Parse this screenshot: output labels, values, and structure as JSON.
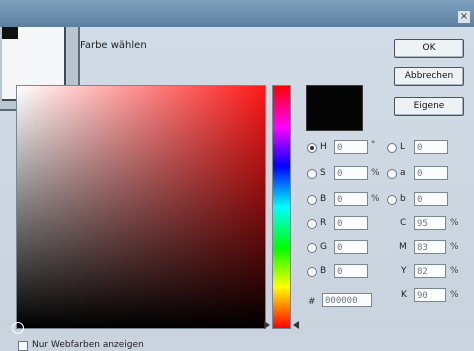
{
  "window": {
    "title": "Farbe wählen",
    "close_glyph": "×"
  },
  "buttons": {
    "ok": "OK",
    "cancel": "Abbrechen",
    "custom": "Eigene"
  },
  "hsb": [
    {
      "label": "H",
      "value": "0",
      "unit": "°",
      "checked": true
    },
    {
      "label": "S",
      "value": "0",
      "unit": "%",
      "checked": false
    },
    {
      "label": "B",
      "value": "0",
      "unit": "%",
      "checked": false
    }
  ],
  "rgb": [
    {
      "label": "R",
      "value": "0"
    },
    {
      "label": "G",
      "value": "0"
    },
    {
      "label": "B",
      "value": "0"
    }
  ],
  "lab": [
    {
      "label": "L",
      "value": "0"
    },
    {
      "label": "a",
      "value": "0"
    },
    {
      "label": "b",
      "value": "0"
    }
  ],
  "cmyk": [
    {
      "label": "C",
      "value": "95",
      "unit": "%"
    },
    {
      "label": "M",
      "value": "83",
      "unit": "%"
    },
    {
      "label": "Y",
      "value": "82",
      "unit": "%"
    },
    {
      "label": "K",
      "value": "90",
      "unit": "%"
    }
  ],
  "hex": {
    "prefix": "#",
    "value": "000000"
  },
  "web_colors_only": {
    "label": "Nur Webfarben anzeigen",
    "checked": false
  },
  "colors": {
    "selected": "#000000",
    "picker_hue": "#ff1818"
  }
}
